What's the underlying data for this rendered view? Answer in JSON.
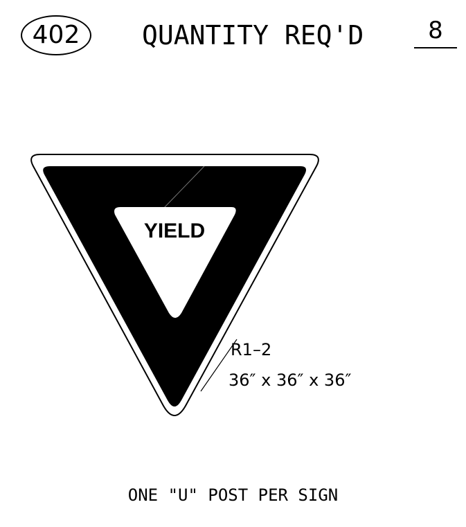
{
  "header": {
    "sign_number": "402",
    "title": "QUANTITY REQ'D",
    "quantity": "8"
  },
  "sign": {
    "legend": "YIELD",
    "code": "R1–2",
    "dimensions": "36″ x 36″ x 36″",
    "colors": {
      "background": "#000000",
      "border": "#ffffff",
      "legend_panel": "#ffffff",
      "legend_text": "#000000"
    }
  },
  "footer": {
    "note": "ONE \"U\" POST PER SIGN"
  }
}
